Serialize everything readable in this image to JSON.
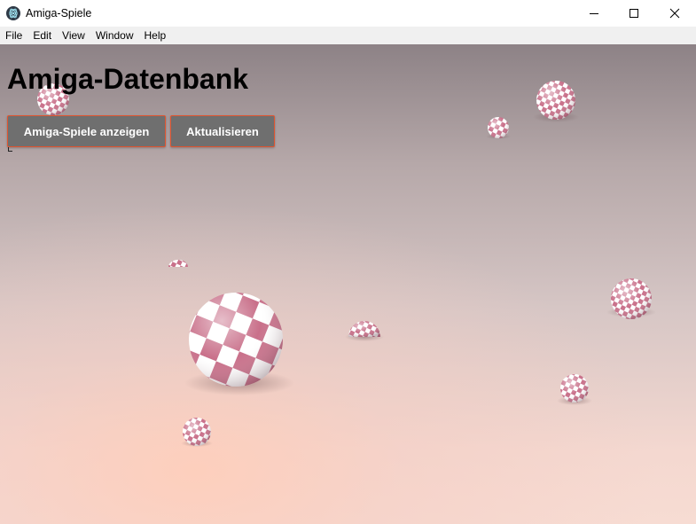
{
  "window": {
    "title": "Amiga-Spiele",
    "controls": [
      "minimize-icon",
      "maximize-icon",
      "close-icon"
    ]
  },
  "menu": {
    "items": [
      {
        "label": "File"
      },
      {
        "label": "Edit"
      },
      {
        "label": "View"
      },
      {
        "label": "Window"
      },
      {
        "label": "Help"
      }
    ]
  },
  "main": {
    "heading": "Amiga-Datenbank",
    "buttons": {
      "show_games": "Amiga-Spiele anzeigen",
      "refresh": "Aktualisieren"
    }
  },
  "colors": {
    "button_background": "#6f6f6f",
    "button_border": "#e0542f",
    "checker_pink": "#c9708a",
    "checker_white": "#ffffff"
  },
  "background": {
    "description_icon": "amiga-boing-ball-wallpaper"
  }
}
